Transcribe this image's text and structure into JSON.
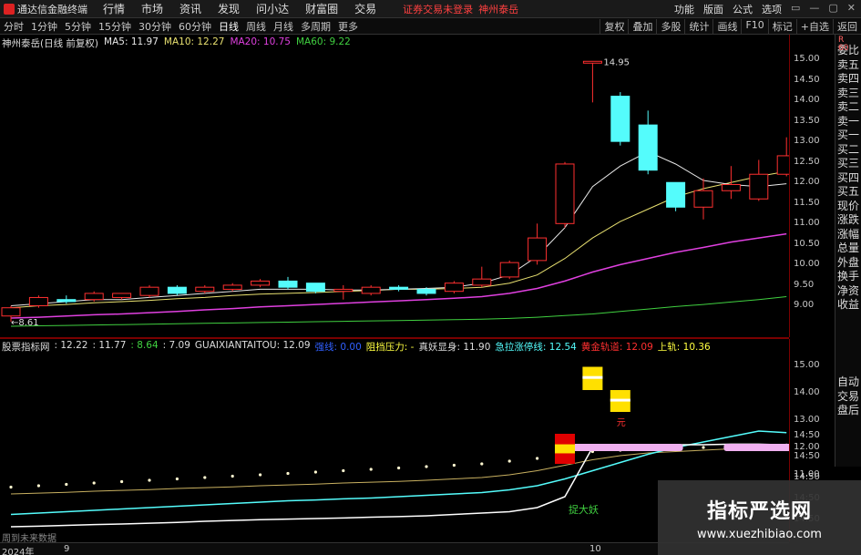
{
  "menubar": {
    "app_title": "通达信金融终端",
    "items": [
      "行情",
      "市场",
      "资讯",
      "发现",
      "问小达",
      "财富圈",
      "交易"
    ],
    "notice": "证券交易未登录",
    "stock": "神州泰岳",
    "right_items": [
      "功能",
      "版面",
      "公式",
      "选项"
    ],
    "win_buttons": [
      "▭",
      "—",
      "▢",
      "✕"
    ]
  },
  "periodbar": {
    "periods": [
      "分时",
      "1分钟",
      "5分钟",
      "15分钟",
      "30分钟",
      "60分钟",
      "日线",
      "周线",
      "月线",
      "多周期",
      "更多"
    ],
    "active": "日线",
    "tools": [
      "复权",
      "叠加",
      "多股",
      "统计",
      "画线",
      "F10",
      "标记",
      "+自选",
      "返回"
    ]
  },
  "main_info": {
    "title": "神州泰岳(日线 前复权)",
    "ma5": "MA5: 11.97",
    "ma10": "MA10: 12.27",
    "ma20": "MA20: 10.75",
    "ma60": "MA60: 9.22",
    "high_label": "14.95",
    "low_label": "8.61"
  },
  "sub_info": {
    "title": "股票指标网",
    "v1": ": 12.22",
    "v2": ": 11.77",
    "v3": ": 8.64",
    "v4": ": 7.09",
    "guai": "GUAIXIANTAITOU: 12.09",
    "f1": "强线: 0.00",
    "f2": "阻挡压力: -",
    "f3": "真妖显身: 11.90",
    "f4": "急拉涨停线: 12.54",
    "f5": "黄金轨道: 12.09",
    "f6": "上轨: 10.36",
    "annot1": "元",
    "annot2": "捉大妖"
  },
  "main_axis": [
    "15.00",
    "14.50",
    "14.00",
    "13.50",
    "13.00",
    "12.50",
    "12.00",
    "11.50",
    "11.00",
    "10.50",
    "10.00",
    "9.50",
    "9.00"
  ],
  "sub_axis": [
    "15.00",
    "14.00",
    "13.00",
    "12.00",
    "11.00",
    "14:50",
    "14:50",
    "14:50",
    "14:50",
    "14:50"
  ],
  "right_panel_top": [
    "委比",
    "卖五",
    "卖四",
    "卖三",
    "卖二",
    "卖一",
    "买一",
    "买二",
    "买三",
    "买四",
    "买五",
    "现价",
    "涨跌",
    "涨幅",
    "总量",
    "外盘",
    "换手",
    "净资",
    "收益"
  ],
  "right_panel_bot": [
    "自动",
    "交易",
    "盘后"
  ],
  "right_corner": "R\n60",
  "bottombar": {
    "year": "2024年",
    "month1": "9",
    "month2": "10"
  },
  "nodata": "周到未来数据",
  "watermark": {
    "title": "指标严选网",
    "url": "www.xuezhibiao.com"
  },
  "colors": {
    "up": "#ff3030",
    "down": "#54fcfc",
    "ma5": "#e8e8e8",
    "ma10": "#e8e070",
    "ma20": "#e040e0",
    "ma60": "#40d040",
    "axis_border": "#7a0000"
  },
  "chart_data": {
    "type": "candlestick",
    "price_range": [
      8.5,
      15.2
    ],
    "candles": [
      {
        "o": 8.75,
        "c": 8.95,
        "h": 9.0,
        "l": 8.61
      },
      {
        "o": 9.0,
        "c": 9.2,
        "h": 9.25,
        "l": 8.95
      },
      {
        "o": 9.15,
        "c": 9.1,
        "h": 9.25,
        "l": 9.05
      },
      {
        "o": 9.15,
        "c": 9.3,
        "h": 9.35,
        "l": 9.1
      },
      {
        "o": 9.2,
        "c": 9.3,
        "h": 9.3,
        "l": 9.15
      },
      {
        "o": 9.25,
        "c": 9.45,
        "h": 9.5,
        "l": 9.2
      },
      {
        "o": 9.45,
        "c": 9.3,
        "h": 9.5,
        "l": 9.25
      },
      {
        "o": 9.35,
        "c": 9.45,
        "h": 9.5,
        "l": 9.3
      },
      {
        "o": 9.4,
        "c": 9.5,
        "h": 9.55,
        "l": 9.35
      },
      {
        "o": 9.5,
        "c": 9.6,
        "h": 9.65,
        "l": 9.45
      },
      {
        "o": 9.6,
        "c": 9.45,
        "h": 9.7,
        "l": 9.4
      },
      {
        "o": 9.55,
        "c": 9.35,
        "h": 9.55,
        "l": 9.3
      },
      {
        "o": 9.35,
        "c": 9.4,
        "h": 9.5,
        "l": 9.15
      },
      {
        "o": 9.3,
        "c": 9.45,
        "h": 9.5,
        "l": 9.25
      },
      {
        "o": 9.45,
        "c": 9.4,
        "h": 9.5,
        "l": 9.35
      },
      {
        "o": 9.4,
        "c": 9.3,
        "h": 9.45,
        "l": 9.25
      },
      {
        "o": 9.35,
        "c": 9.55,
        "h": 9.6,
        "l": 9.3
      },
      {
        "o": 9.5,
        "c": 9.65,
        "h": 9.95,
        "l": 9.45
      },
      {
        "o": 9.7,
        "c": 10.05,
        "h": 10.1,
        "l": 9.65
      },
      {
        "o": 10.1,
        "c": 10.65,
        "h": 11.0,
        "l": 10.0
      },
      {
        "o": 11.0,
        "c": 12.45,
        "h": 12.5,
        "l": 10.9
      },
      {
        "o": 14.95,
        "c": 14.95,
        "h": 14.95,
        "l": 13.95
      },
      {
        "o": 14.1,
        "c": 13.0,
        "h": 14.2,
        "l": 12.9
      },
      {
        "o": 13.4,
        "c": 12.3,
        "h": 13.75,
        "l": 12.2
      },
      {
        "o": 12.0,
        "c": 11.4,
        "h": 12.0,
        "l": 11.3
      },
      {
        "o": 11.4,
        "c": 11.8,
        "h": 12.1,
        "l": 11.1
      },
      {
        "o": 11.8,
        "c": 11.95,
        "h": 12.4,
        "l": 11.6
      },
      {
        "o": 11.6,
        "c": 12.2,
        "h": 12.55,
        "l": 11.55
      },
      {
        "o": 12.2,
        "c": 12.65,
        "h": 13.1,
        "l": 12.15
      }
    ],
    "ma5": [
      9.0,
      9.05,
      9.1,
      9.15,
      9.15,
      9.2,
      9.25,
      9.3,
      9.35,
      9.4,
      9.4,
      9.4,
      9.38,
      9.38,
      9.4,
      9.42,
      9.45,
      9.55,
      9.75,
      10.2,
      10.9,
      11.9,
      12.4,
      12.75,
      12.45,
      12.05,
      11.95,
      11.9,
      11.97
    ],
    "ma10": [
      8.95,
      9.0,
      9.03,
      9.07,
      9.1,
      9.13,
      9.17,
      9.2,
      9.25,
      9.28,
      9.3,
      9.32,
      9.35,
      9.37,
      9.4,
      9.4,
      9.42,
      9.45,
      9.55,
      9.75,
      10.15,
      10.65,
      11.05,
      11.35,
      11.65,
      11.85,
      12.0,
      12.15,
      12.27
    ],
    "ma20": [
      8.7,
      8.72,
      8.75,
      8.78,
      8.8,
      8.83,
      8.86,
      8.9,
      8.93,
      8.97,
      9.0,
      9.03,
      9.06,
      9.09,
      9.12,
      9.15,
      9.18,
      9.22,
      9.3,
      9.42,
      9.6,
      9.82,
      10.0,
      10.15,
      10.3,
      10.42,
      10.55,
      10.65,
      10.75
    ],
    "ma60": [
      8.5,
      8.51,
      8.52,
      8.53,
      8.54,
      8.55,
      8.56,
      8.57,
      8.58,
      8.59,
      8.6,
      8.61,
      8.62,
      8.63,
      8.64,
      8.65,
      8.66,
      8.67,
      8.69,
      8.72,
      8.76,
      8.8,
      8.86,
      8.92,
      8.98,
      9.03,
      9.09,
      9.15,
      9.22
    ],
    "sub": {
      "range": [
        8.8,
        15.5
      ],
      "white": [
        9.1,
        9.12,
        9.15,
        9.18,
        9.2,
        9.23,
        9.26,
        9.3,
        9.33,
        9.36,
        9.38,
        9.4,
        9.42,
        9.45,
        9.47,
        9.5,
        9.55,
        9.6,
        9.65,
        9.8,
        10.2,
        12.0,
        12.05,
        12.08,
        12.1,
        12.1,
        12.12,
        12.12,
        12.09
      ],
      "cyan": [
        9.55,
        9.6,
        9.65,
        9.7,
        9.75,
        9.8,
        9.85,
        9.9,
        9.95,
        10.0,
        10.05,
        10.08,
        10.12,
        10.15,
        10.2,
        10.25,
        10.3,
        10.35,
        10.45,
        10.6,
        10.85,
        11.15,
        11.45,
        11.75,
        12.0,
        12.2,
        12.4,
        12.6,
        12.54
      ],
      "gold": [
        10.3,
        10.33,
        10.36,
        10.4,
        10.43,
        10.46,
        10.5,
        10.53,
        10.56,
        10.6,
        10.63,
        10.66,
        10.7,
        10.73,
        10.76,
        10.8,
        10.85,
        10.9,
        11.0,
        11.15,
        11.35,
        11.55,
        11.7,
        11.8,
        11.85,
        11.9,
        11.95,
        12.0,
        12.09
      ],
      "dots": [
        10.55,
        10.6,
        10.65,
        10.7,
        10.75,
        10.8,
        10.85,
        10.9,
        10.95,
        11.0,
        11.05,
        11.1,
        11.15,
        11.2,
        11.25,
        11.3,
        11.35,
        11.4,
        11.5,
        11.6,
        11.75,
        11.85,
        11.9,
        11.95,
        12.0,
        12.0,
        12.02,
        12.05,
        12.09
      ],
      "red_blocks": [
        {
          "i": 20,
          "top": 12.5,
          "bot": 11.4
        }
      ],
      "yellow_blocks": [
        {
          "i": 21,
          "top": 14.95,
          "bot": 14.1
        },
        {
          "i": 22,
          "top": 14.1,
          "bot": 13.3
        }
      ],
      "pink_bars": [
        {
          "from": 20,
          "to": 24,
          "v": 12.0
        },
        {
          "from": 26,
          "to": 28,
          "v": 12.0
        }
      ]
    }
  }
}
